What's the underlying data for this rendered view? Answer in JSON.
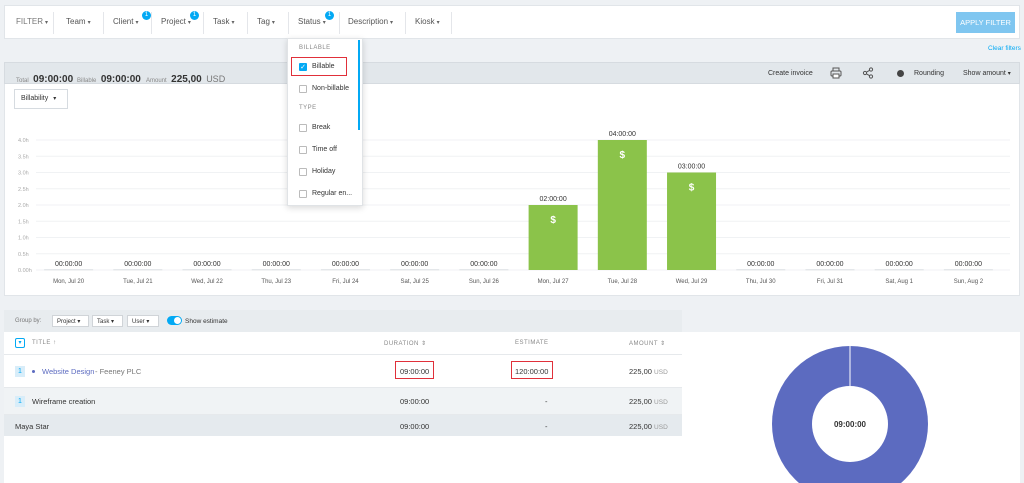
{
  "filters": {
    "filter_label": "FILTER",
    "items": [
      {
        "label": "Team",
        "badge": ""
      },
      {
        "label": "Client",
        "badge": "1"
      },
      {
        "label": "Project",
        "badge": "1"
      },
      {
        "label": "Task",
        "badge": ""
      },
      {
        "label": "Tag",
        "badge": ""
      },
      {
        "label": "Status",
        "badge": "1"
      },
      {
        "label": "Description",
        "badge": ""
      },
      {
        "label": "Kiosk",
        "badge": ""
      }
    ],
    "apply_label": "APPLY FILTER",
    "clear_label": "Clear filters"
  },
  "status_dropdown": {
    "billable_header": "BILLABLE",
    "billable_items": [
      {
        "label": "Billable",
        "checked": true
      },
      {
        "label": "Non-billable",
        "checked": false
      }
    ],
    "type_header": "TYPE",
    "type_items": [
      {
        "label": "Break",
        "checked": false
      },
      {
        "label": "Time off",
        "checked": false
      },
      {
        "label": "Holiday",
        "checked": false
      },
      {
        "label": "Regular en...",
        "checked": false
      }
    ]
  },
  "summary": {
    "total_label": "Total",
    "total_value": "09:00:00",
    "billable_label": "Billable",
    "billable_value": "09:00:00",
    "amount_label": "Amount",
    "amount_value": "225,00",
    "amount_currency": "USD",
    "create_invoice": "Create invoice",
    "rounding": "Rounding",
    "show_amount": "Show amount"
  },
  "billability_select": "Billability",
  "chart_data": {
    "type": "bar",
    "yticks": [
      "4.0h",
      "3.5h",
      "3.0h",
      "2.5h",
      "2.0h",
      "1.5h",
      "1.0h",
      "0.5h",
      "0.00h"
    ],
    "ylim": [
      0,
      4
    ],
    "categories": [
      "Mon, Jul 20",
      "Tue, Jul 21",
      "Wed, Jul 22",
      "Thu, Jul 23",
      "Fri, Jul 24",
      "Sat, Jul 25",
      "Sun, Jul 26",
      "Mon, Jul 27",
      "Tue, Jul 28",
      "Wed, Jul 29",
      "Thu, Jul 30",
      "Fri, Jul 31",
      "Sat, Aug 1",
      "Sun, Aug 2"
    ],
    "values": [
      0,
      0,
      0,
      0,
      0,
      0,
      0,
      2,
      4,
      3,
      0,
      0,
      0,
      0
    ],
    "labels": [
      "00:00:00",
      "00:00:00",
      "00:00:00",
      "00:00:00",
      "00:00:00",
      "00:00:00",
      "00:00:00",
      "02:00:00",
      "04:00:00",
      "03:00:00",
      "00:00:00",
      "00:00:00",
      "00:00:00",
      "00:00:00"
    ],
    "bar_symbol": "$",
    "bar_color": "#8bc34a"
  },
  "group": {
    "label": "Group by:",
    "selects": [
      "Project",
      "Task",
      "User"
    ],
    "show_estimate": "Show estimate"
  },
  "table": {
    "headers": {
      "title": "TITLE",
      "duration": "DURATION",
      "estimate": "ESTIMATE",
      "amount": "AMOUNT"
    },
    "rows": [
      {
        "num": "1",
        "title": "Website Design",
        "client": "- Feeney PLC",
        "duration": "09:00:00",
        "estimate": "120:00:00",
        "amount": "225,00",
        "currency": "USD"
      },
      {
        "num": "1",
        "title": "Wireframe creation",
        "client": "",
        "duration": "09:00:00",
        "estimate": "-",
        "amount": "225,00",
        "currency": "USD"
      },
      {
        "num": "",
        "title": "Maya Star",
        "client": "",
        "duration": "09:00:00",
        "estimate": "-",
        "amount": "225,00",
        "currency": "USD"
      }
    ]
  },
  "donut": {
    "center_label": "09:00:00",
    "color": "#5c6bc0"
  }
}
